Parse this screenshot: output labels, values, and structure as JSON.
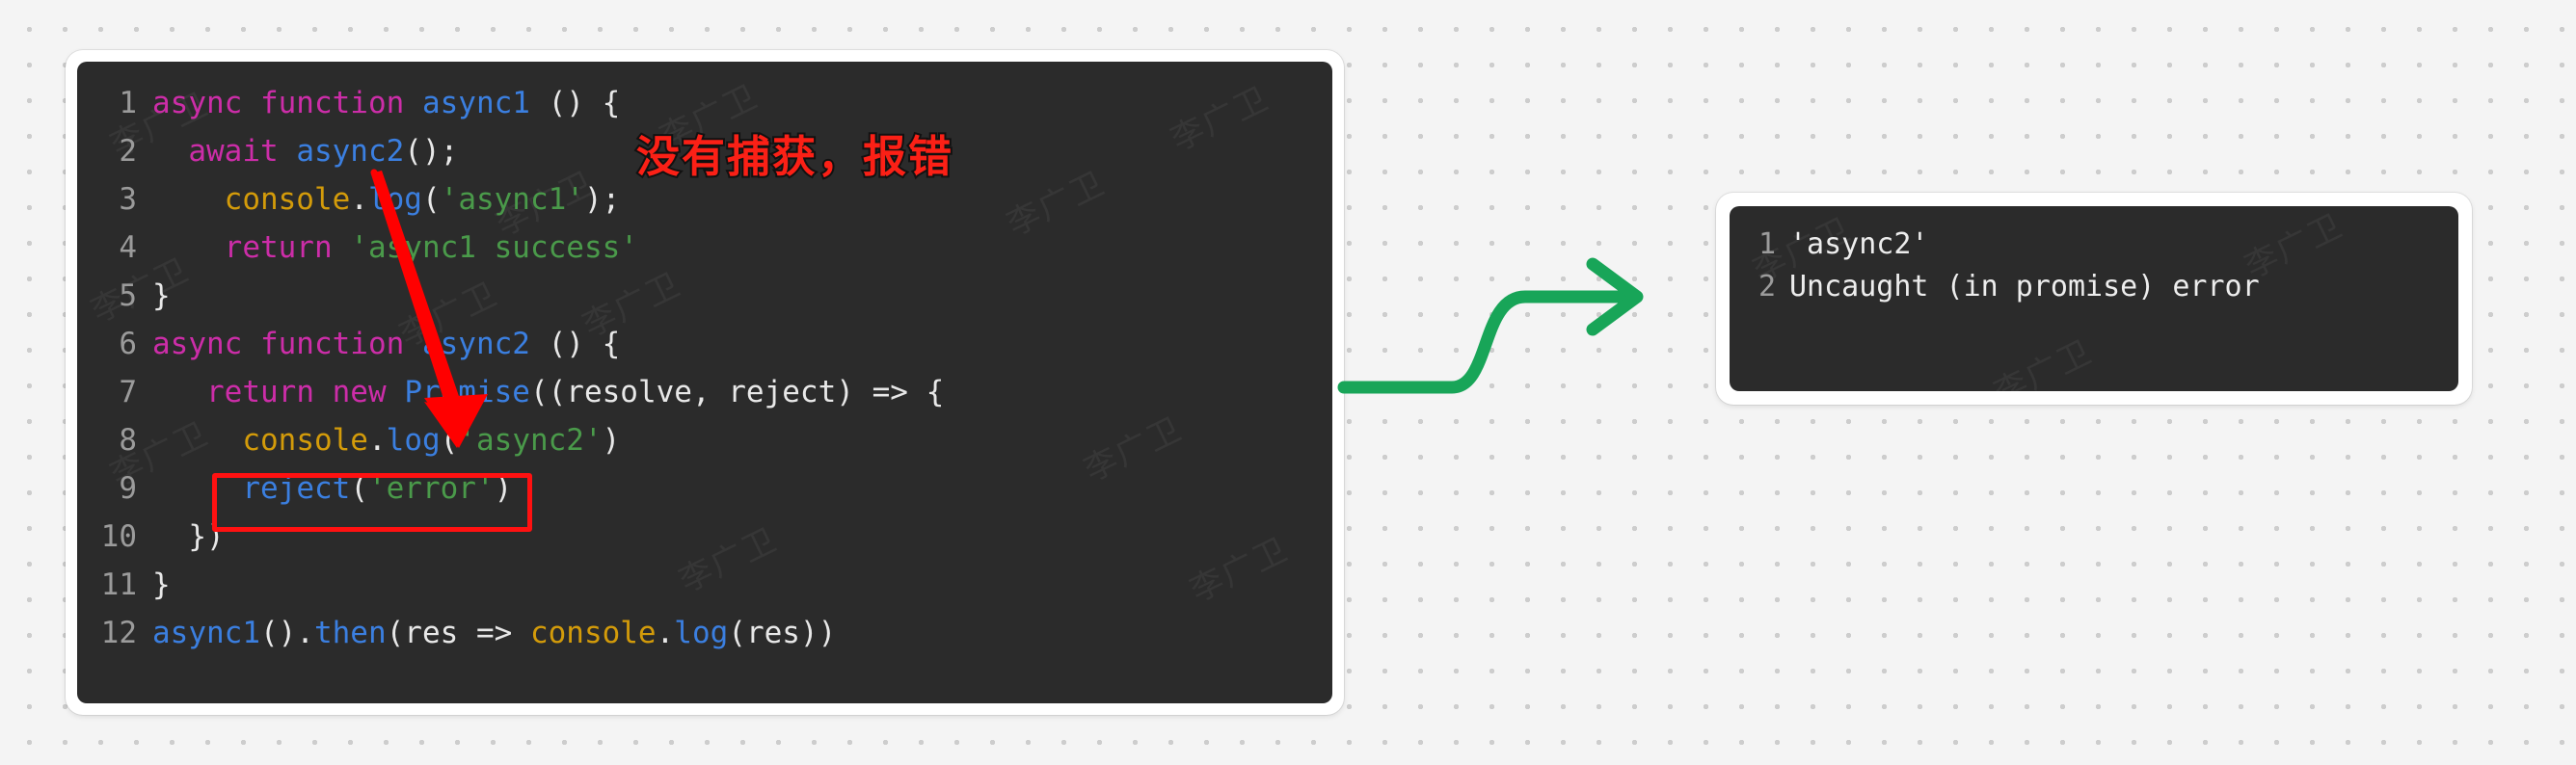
{
  "background": {
    "color": "#f4f4f4",
    "dot_color": "#cdcdcd",
    "dot_spacing_px": 37
  },
  "watermark": {
    "text": "李广卫"
  },
  "code_panel": {
    "name": "javascript-code-snippet",
    "background": "#2b2b2b",
    "lines": [
      {
        "num": "1",
        "text": "async function async1 () {"
      },
      {
        "num": "2",
        "text": "  await async2();"
      },
      {
        "num": "3",
        "text": "    console.log('async1');"
      },
      {
        "num": "4",
        "text": "    return 'async1 success'"
      },
      {
        "num": "5",
        "text": "}"
      },
      {
        "num": "6",
        "text": "async function async2 () {"
      },
      {
        "num": "7",
        "text": "    return new Promise((resolve, reject) => {"
      },
      {
        "num": "8",
        "text": "      console.log('async2')"
      },
      {
        "num": "9",
        "text": "      reject('error')"
      },
      {
        "num": "10",
        "text": "   })"
      },
      {
        "num": "11",
        "text": "}"
      },
      {
        "num": "12",
        "text": "async1().then(res => console.log(res))"
      }
    ]
  },
  "console_panel": {
    "name": "browser-console-output",
    "background": "#2b2b2b",
    "lines": [
      {
        "num": "1",
        "text": "'async2'"
      },
      {
        "num": "2",
        "text": "Uncaught (in promise) error"
      }
    ]
  },
  "annotations": {
    "note_text": "没有捕获，报错",
    "note_color": "#fb2016",
    "note_stroke_color": "#111111",
    "red_arrow_color": "#ff0000",
    "red_box_color": "#ff1111",
    "red_box_target": "reject('error')",
    "green_arrow_color": "#18a558"
  },
  "colors": {
    "keyword": "#cc2da8",
    "function": "#3b7fe0",
    "string": "#4a9a4a",
    "object": "#d39b0a",
    "plain": "#e8e8e8",
    "line_number": "#9b9b9b"
  }
}
